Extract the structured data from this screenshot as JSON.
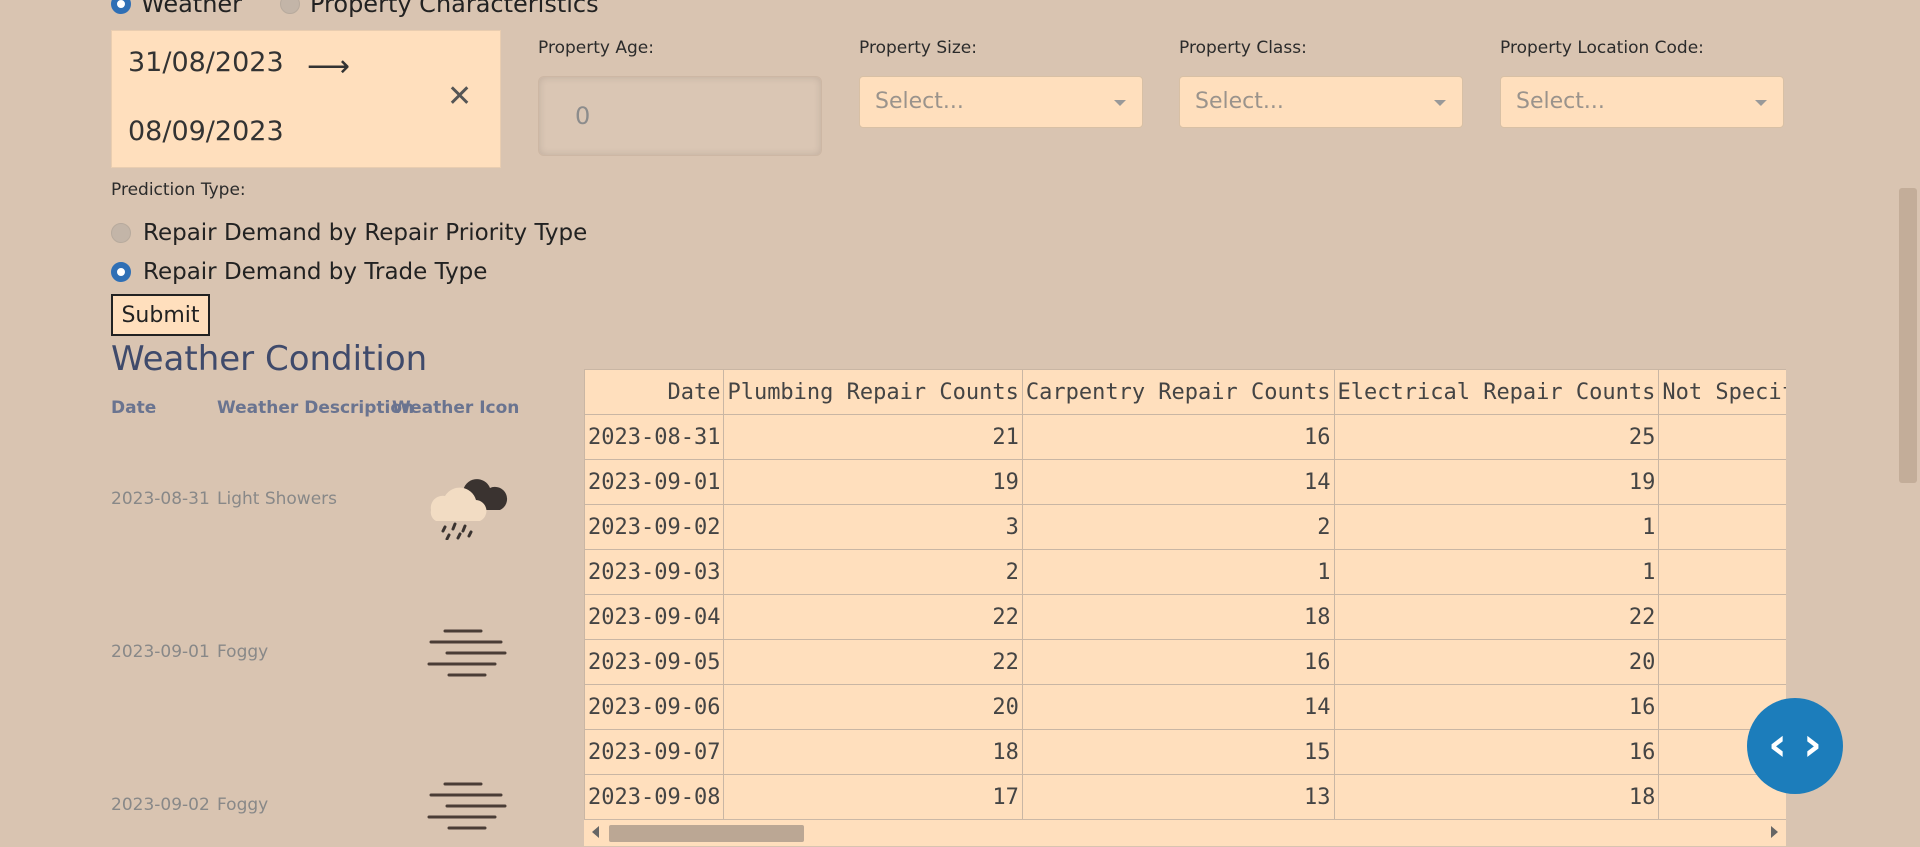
{
  "top_radios": [
    {
      "label": "Weather",
      "selected": true
    },
    {
      "label": "Property Characteristics",
      "selected": false
    }
  ],
  "date_range": {
    "start": "31/08/2023",
    "end": "08/09/2023",
    "arrow": "⟶",
    "clear": "✕"
  },
  "filters": {
    "property_age": {
      "label": "Property Age:",
      "value": "0"
    },
    "property_size": {
      "label": "Property Size:",
      "placeholder": "Select..."
    },
    "property_class": {
      "label": "Property Class:",
      "placeholder": "Select..."
    },
    "property_location": {
      "label": "Property Location Code:",
      "placeholder": "Select..."
    }
  },
  "prediction_type": {
    "label": "Prediction Type:",
    "options": [
      {
        "label": "Repair Demand by Repair Priority Type",
        "selected": false
      },
      {
        "label": "Repair Demand by Trade Type",
        "selected": true
      }
    ]
  },
  "submit_label": "Submit",
  "weather_condition": {
    "title": "Weather Condition",
    "headers": [
      "Date",
      "Weather Description",
      "Weather Icon"
    ],
    "rows": [
      {
        "date": "2023-08-31",
        "desc": "Light Showers",
        "icon": "rain-showers-icon"
      },
      {
        "date": "2023-09-01",
        "desc": "Foggy",
        "icon": "fog-icon"
      },
      {
        "date": "2023-09-02",
        "desc": "Foggy",
        "icon": "fog-icon"
      }
    ]
  },
  "table": {
    "headers": [
      "Date",
      "Plumbing Repair Counts",
      "Carpentry Repair Counts",
      "Electrical Repair Counts",
      "Not Specif"
    ],
    "rows": [
      [
        "2023-08-31",
        "21",
        "16",
        "25",
        ""
      ],
      [
        "2023-09-01",
        "19",
        "14",
        "19",
        ""
      ],
      [
        "2023-09-02",
        "3",
        "2",
        "1",
        ""
      ],
      [
        "2023-09-03",
        "2",
        "1",
        "1",
        ""
      ],
      [
        "2023-09-04",
        "22",
        "18",
        "22",
        ""
      ],
      [
        "2023-09-05",
        "22",
        "16",
        "20",
        ""
      ],
      [
        "2023-09-06",
        "20",
        "14",
        "16",
        ""
      ],
      [
        "2023-09-07",
        "18",
        "15",
        "16",
        ""
      ],
      [
        "2023-09-08",
        "17",
        "13",
        "18",
        ""
      ]
    ]
  },
  "code_button_icon": "code-brackets-icon",
  "code_button_glyph": "‹ ›",
  "colors": {
    "background": "#d9c4b1",
    "panel": "#ffdfbd",
    "accent": "#2f6fb5",
    "title": "#3f4a6b",
    "code_button": "#1c7dbb"
  }
}
